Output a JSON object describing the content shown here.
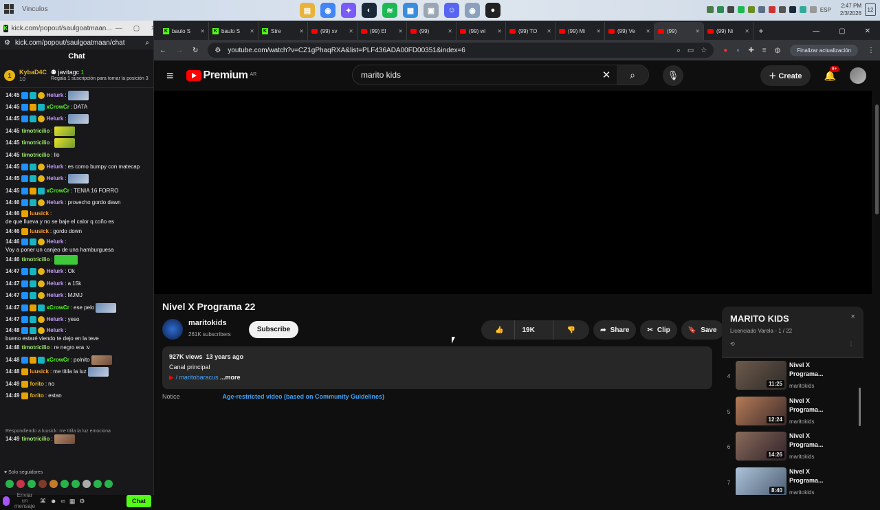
{
  "taskbar": {
    "search_label": "Vinculos",
    "apps": [
      "explorer",
      "chrome",
      "copilot",
      "steam",
      "spotify",
      "store",
      "photos",
      "discord",
      "chrome-active",
      "obs"
    ],
    "lang": "ESP",
    "time": "2:47 PM",
    "date": "2/3/2026",
    "notif_count": "12"
  },
  "chat_window": {
    "title": "kick.com/popout/saulgoatmaan...",
    "url": "kick.com/popout/saulgoatmaan/chat",
    "header": "Chat",
    "pinned": {
      "rank": "1",
      "user": "KybaD4C",
      "level": "10",
      "gifter": "javitagc",
      "gift_count": "1",
      "gift_text": "Regala 1 suscripción para tomar la posición 3"
    },
    "messages": [
      {
        "time": "14:45",
        "user": "Helurk",
        "text": "",
        "color": "#c79bff",
        "emote": true
      },
      {
        "time": "14:45",
        "user": "xCrowCr",
        "text": "DATA",
        "color": "#53fc18"
      },
      {
        "time": "14:45",
        "user": "Helurk",
        "text": "",
        "color": "#c79bff",
        "emote": true
      },
      {
        "time": "14:45",
        "user": "timotricilio",
        "text": "",
        "color": "#9ee86a",
        "emote": true
      },
      {
        "time": "14:45",
        "user": "timotricilio",
        "text": "",
        "color": "#9ee86a",
        "emote": true
      },
      {
        "time": "14:45",
        "user": "timotricilio",
        "text": "llo",
        "color": "#9ee86a"
      },
      {
        "time": "14:45",
        "user": "Helurk",
        "text": "es como bumpy con matecap",
        "color": "#c79bff"
      },
      {
        "time": "14:45",
        "user": "Helurk",
        "text": "",
        "color": "#c79bff",
        "emote": true
      },
      {
        "time": "14:45",
        "user": "xCrowCr",
        "text": "TENIA 16 FORRO",
        "color": "#53fc18"
      },
      {
        "time": "14:46",
        "user": "Helurk",
        "text": "provecho gordo dawn",
        "color": "#c79bff"
      },
      {
        "time": "14:46",
        "user": "luusick",
        "text": "de que llueva y no se baje el calor q coño es",
        "color": "#ff9d2e"
      },
      {
        "time": "14:46",
        "user": "luusick",
        "text": "gordo down",
        "color": "#ff9d2e"
      },
      {
        "time": "14:46",
        "user": "Helurk",
        "text": "Voy a poner un canjeo de una hamburguesa",
        "color": "#c79bff"
      },
      {
        "time": "14:46",
        "user": "timotricilio",
        "text": "",
        "color": "#9ee86a",
        "emote": true
      },
      {
        "time": "14:47",
        "user": "Helurk",
        "text": "Ok",
        "color": "#c79bff"
      },
      {
        "time": "14:47",
        "user": "Helurk",
        "text": "a 15k",
        "color": "#c79bff"
      },
      {
        "time": "14:47",
        "user": "Helurk",
        "text": "MJMJ",
        "color": "#c79bff"
      },
      {
        "time": "14:47",
        "user": "xCrowCr",
        "text": "ese pelo",
        "color": "#53fc18",
        "emote": true
      },
      {
        "time": "14:47",
        "user": "Helurk",
        "text": "yeso",
        "color": "#c79bff"
      },
      {
        "time": "14:48",
        "user": "Helurk",
        "text": "bueno estaré viendo te dejo en la teve",
        "color": "#c79bff"
      },
      {
        "time": "14:48",
        "user": "timotricilio",
        "text": "re negro era :v",
        "color": "#9ee86a"
      },
      {
        "time": "14:48",
        "user": "xCrowCr",
        "text": "polnito",
        "color": "#53fc18",
        "emote": true
      },
      {
        "time": "14:48",
        "user": "luusick",
        "text": "me titila la luz",
        "color": "#ff9d2e",
        "emote": true
      },
      {
        "time": "14:49",
        "user": "forito",
        "text": "no",
        "color": "#e7b416"
      },
      {
        "time": "14:49",
        "user": "forito",
        "text": "estan",
        "color": "#e7b416"
      }
    ],
    "reply_note": "Respondiendo a luusick: me titila la luz emociona",
    "last_message": {
      "time": "14:49",
      "user": "timotricilio",
      "color": "#9ee86a"
    },
    "followers_only": "Solo seguidores",
    "input_placeholder": "Enviar un mensaje",
    "chat_button": "Chat"
  },
  "browser": {
    "tabs": [
      {
        "label": "baulo S",
        "icon": "kick"
      },
      {
        "label": "baulo S",
        "icon": "kick"
      },
      {
        "label": "Stre",
        "icon": "kick"
      },
      {
        "label": "(99) xv",
        "icon": "yt"
      },
      {
        "label": "(99) El",
        "icon": "yt"
      },
      {
        "label": "(99)",
        "icon": "yt"
      },
      {
        "label": "(99) wi",
        "icon": "yt"
      },
      {
        "label": "(99) TO",
        "icon": "yt"
      },
      {
        "label": "(99) Mi",
        "icon": "yt"
      },
      {
        "label": "(99) Ve",
        "icon": "yt"
      },
      {
        "label": "(99)",
        "icon": "yt",
        "active": true
      },
      {
        "label": "(99) Ni",
        "icon": "yt"
      }
    ],
    "url": "youtube.com/watch?v=CZ1gPhaqRXA&list=PLF436ADA00FD00351&index=6",
    "update_button": "Finalizar actualización"
  },
  "youtube": {
    "logo": "Premium",
    "region": "AR",
    "search_value": "marito kids",
    "create": "Create",
    "notifications": "9+",
    "video_title": "Nivel X Programa 22",
    "channel": "maritokids",
    "subscribers": "261K subscribers",
    "subscribe": "Subscribe",
    "likes": "19K",
    "share": "Share",
    "clip": "Clip",
    "save": "Save",
    "views": "927K views",
    "age": "13 years ago",
    "desc_line": "Canal principal",
    "desc_link": "/ maritobaracus",
    "more": "...more",
    "notice_label": "Notice",
    "notice_text": "Age-restricted video (based on Community Guidelines)"
  },
  "playlist": {
    "title": "MARITO KIDS",
    "meta": "Licenciado Varela - 1 / 22",
    "items": [
      {
        "n": "4",
        "title": "Nivel X Programa...",
        "channel": "maritokids",
        "duration": "11:25"
      },
      {
        "n": "5",
        "title": "Nivel X Programa...",
        "channel": "maritokids",
        "duration": "12:24"
      },
      {
        "n": "6",
        "title": "Nivel X Programa...",
        "channel": "maritokids",
        "duration": "14:26"
      },
      {
        "n": "7",
        "title": "Nivel X Programa...",
        "channel": "maritokids",
        "duration": "8:40"
      }
    ]
  }
}
